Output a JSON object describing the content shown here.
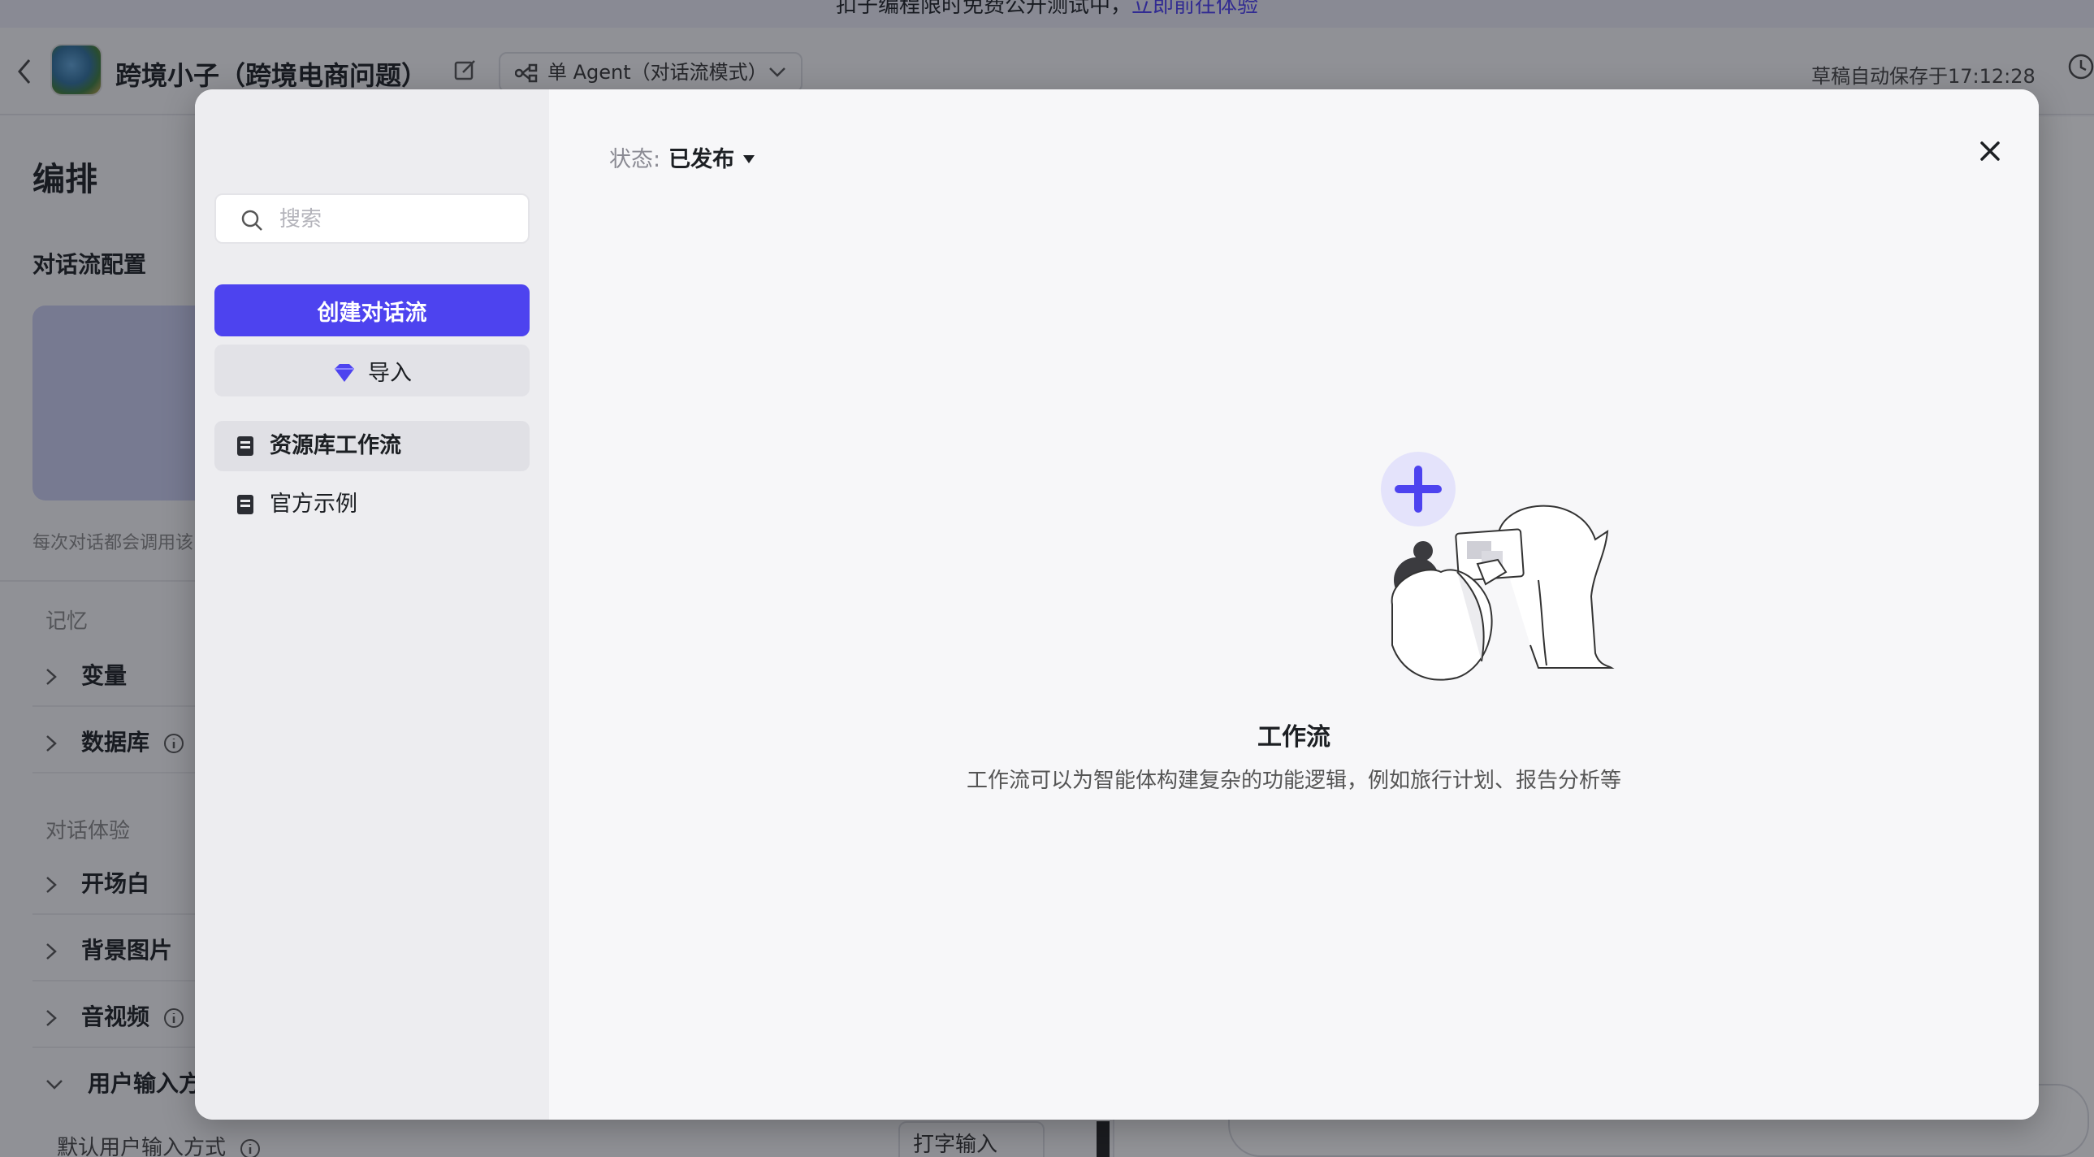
{
  "banner": {
    "text": "扣子编程限时免费公开测试中，",
    "link": "立即前往体验"
  },
  "header": {
    "title": "跨境小子（跨境电商问题）",
    "mode": "单 Agent（对话流模式）",
    "autosave": "草稿自动保存于17:12:28"
  },
  "left_panel": {
    "title": "编排",
    "subtitle": "对话流配置",
    "hint": "每次对话都会调用该",
    "memory_section": "记忆",
    "variables": "变量",
    "database": "数据库",
    "experience_section": "对话体验",
    "opening": "开场白",
    "background": "背景图片",
    "audio_video": "音视频",
    "user_input": "用户输入方",
    "default_input": "默认用户输入方式",
    "input_type": "打字输入"
  },
  "modal": {
    "search_placeholder": "搜索",
    "create_label": "创建对话流",
    "import_label": "导入",
    "nav": [
      {
        "label": "资源库工作流",
        "active": true
      },
      {
        "label": "官方示例",
        "active": false
      }
    ],
    "status_label": "状态:",
    "status_value": "已发布",
    "empty_title": "工作流",
    "empty_desc": "工作流可以为智能体构建复杂的功能逻辑，例如旅行计划、报告分析等"
  },
  "colors": {
    "accent": "#4d43ef",
    "overlay": "rgba(20,22,30,0.45)"
  }
}
